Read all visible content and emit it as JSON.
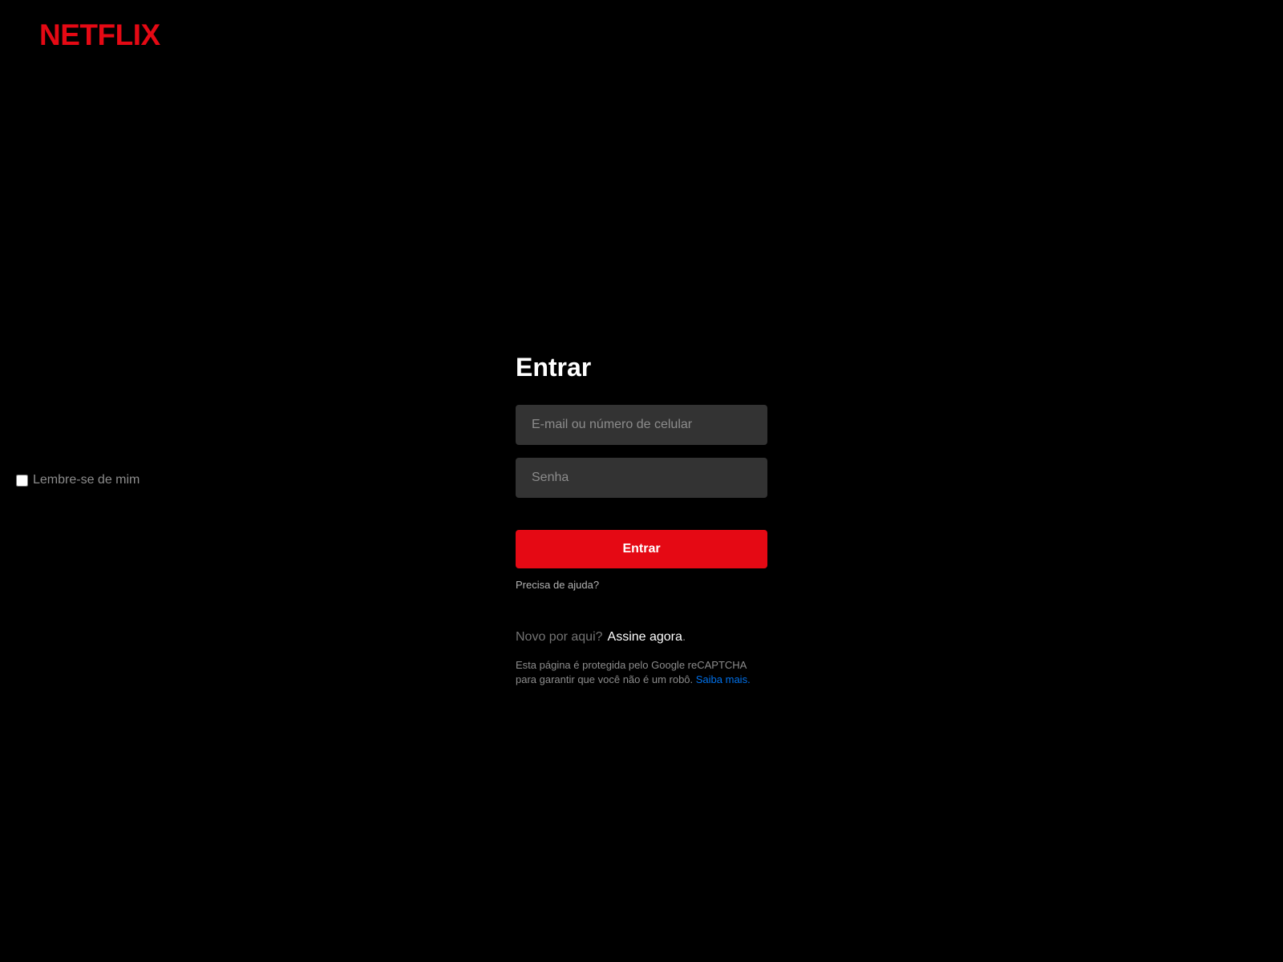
{
  "header": {
    "logo_text": "NETFLIX"
  },
  "colors": {
    "brand": "#e50914",
    "background": "#000000",
    "input_bg": "#333333",
    "link_blue": "#0071eb"
  },
  "remember": {
    "label": "Lembre-se de mim",
    "checked": false
  },
  "login": {
    "title": "Entrar",
    "email_placeholder": "E-mail ou número de celular",
    "email_value": "",
    "password_placeholder": "Senha",
    "password_value": "",
    "submit_label": "Entrar",
    "help_link": "Precisa de ajuda?"
  },
  "signup": {
    "prompt": "Novo por aqui?",
    "link": "Assine agora",
    "suffix": "."
  },
  "captcha": {
    "text": "Esta página é protegida pelo Google reCAPTCHA para garantir que você não é um robô.",
    "link": "Saiba mais."
  }
}
